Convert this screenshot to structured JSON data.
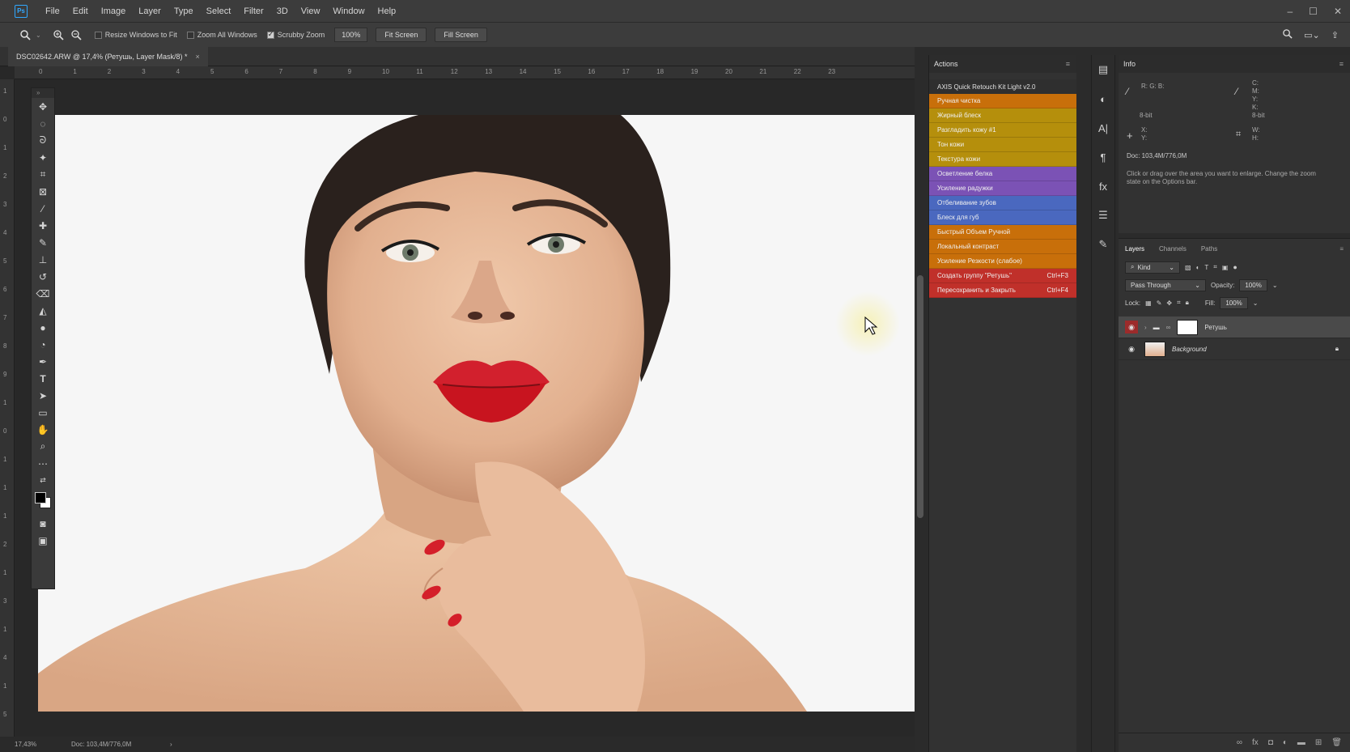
{
  "menu": {
    "logo": "Ps",
    "items": [
      "File",
      "Edit",
      "Image",
      "Layer",
      "Type",
      "Select",
      "Filter",
      "3D",
      "View",
      "Window",
      "Help"
    ]
  },
  "options": {
    "resize_windows": "Resize Windows to Fit",
    "zoom_all": "Zoom All Windows",
    "scrubby_zoom": "Scrubby Zoom",
    "zoom_value": "100%",
    "fit_screen": "Fit Screen",
    "fill_screen": "Fill Screen"
  },
  "document": {
    "tab_title": "DSC02642.ARW @ 17,4% (Ретушь, Layer Mask/8) *",
    "zoom": "17,43%",
    "doc_size": "Doc: 103,4M/776,0M",
    "ruler_h": [
      "0",
      "1",
      "2",
      "3",
      "4",
      "5",
      "6",
      "7",
      "8",
      "9",
      "10",
      "11",
      "12",
      "13",
      "14",
      "15",
      "16",
      "17",
      "18",
      "19",
      "20",
      "21",
      "22",
      "23"
    ],
    "ruler_v": [
      "1",
      "0",
      "1",
      "2",
      "3",
      "4",
      "5",
      "6",
      "7",
      "8",
      "9",
      "1",
      "0",
      "1",
      "1",
      "1",
      "2",
      "1",
      "3",
      "1",
      "4",
      "1",
      "5"
    ]
  },
  "actions": {
    "panel_title": "Actions",
    "kit_title": "AXIS Quick Retouch Kit Light v2.0",
    "buttons": [
      {
        "label": "Ручная чистка",
        "color": "#c86f0a",
        "shortcut": ""
      },
      {
        "label": "Жирный блеск",
        "color": "#b58f0c",
        "shortcut": ""
      },
      {
        "label": "Разгладить кожу #1",
        "color": "#b58f0c",
        "shortcut": ""
      },
      {
        "label": "Тон кожи",
        "color": "#b58f0c",
        "shortcut": ""
      },
      {
        "label": "Текстура кожи",
        "color": "#b58f0c",
        "shortcut": ""
      },
      {
        "label": "Осветление белка",
        "color": "#7b52b5",
        "shortcut": ""
      },
      {
        "label": "Усиление радужки",
        "color": "#7b52b5",
        "shortcut": ""
      },
      {
        "label": "Отбеливание зубов",
        "color": "#4a68bf",
        "shortcut": ""
      },
      {
        "label": "Блеск для губ",
        "color": "#4a68bf",
        "shortcut": ""
      },
      {
        "label": "Быстрый Объем Ручной",
        "color": "#c86f0a",
        "shortcut": ""
      },
      {
        "label": "Локальный контраст",
        "color": "#c86f0a",
        "shortcut": ""
      },
      {
        "label": "Усиление Резкости (слабое)",
        "color": "#c86f0a",
        "shortcut": ""
      },
      {
        "label": "Создать группу \"Ретушь\"",
        "color": "#c0302a",
        "shortcut": "Ctrl+F3"
      },
      {
        "label": "Пересохранить и Закрыть",
        "color": "#c0302a",
        "shortcut": "Ctrl+F4"
      }
    ]
  },
  "info": {
    "title": "Info",
    "bit_left": "8-bit",
    "bit_right": "8-bit",
    "doc": "Doc: 103,4M/776,0M",
    "hint": "Click or drag over the area you want to enlarge. Change the zoom state on the Options bar.",
    "rgb_labels": "R: G: B:",
    "cmyk_labels": [
      "C:",
      "M:",
      "Y:",
      "K:"
    ],
    "xy": [
      "X:",
      "Y:"
    ],
    "wh": [
      "W:",
      "H:"
    ]
  },
  "layers": {
    "tabs": [
      "Layers",
      "Channels",
      "Paths"
    ],
    "kind": "Kind",
    "blend": "Pass Through",
    "opacity_label": "Opacity:",
    "opacity": "100%",
    "lock_label": "Lock:",
    "fill_label": "Fill:",
    "fill": "100%",
    "rows": [
      {
        "name": "Ретушь",
        "selected": true
      },
      {
        "name": "Background",
        "selected": false
      }
    ]
  }
}
